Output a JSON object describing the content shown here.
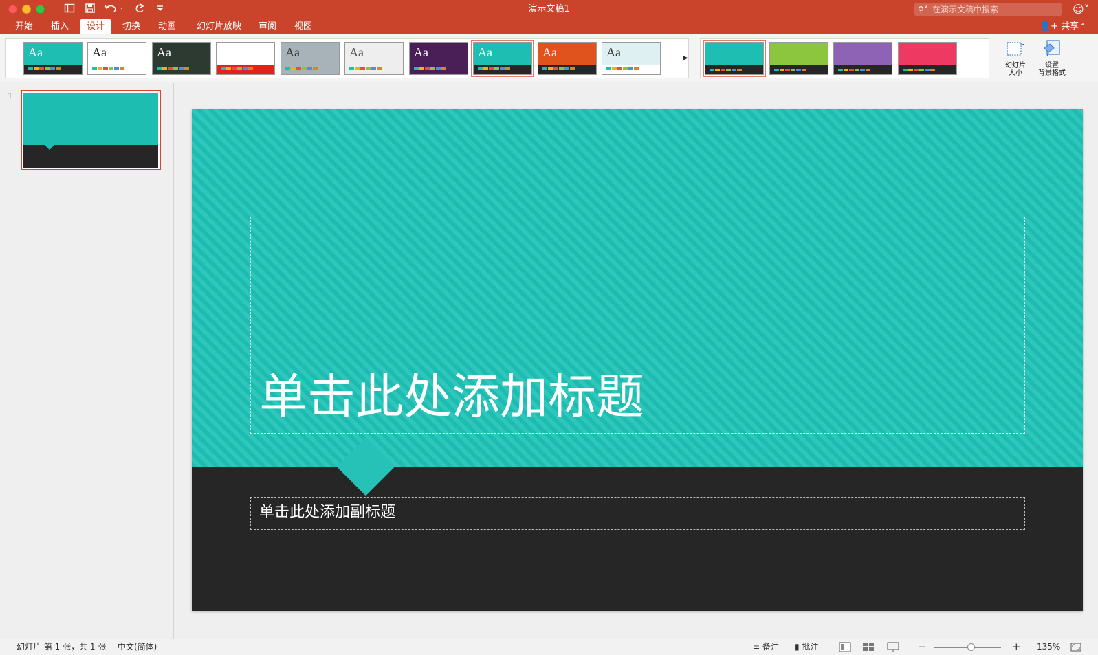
{
  "window": {
    "title": "演示文稿1",
    "search_placeholder": "在演示文稿中搜索"
  },
  "tabs": [
    "开始",
    "插入",
    "设计",
    "切换",
    "动画",
    "幻灯片放映",
    "审阅",
    "视图"
  ],
  "active_tab": "设计",
  "share_label": "共享",
  "themes": [
    {
      "aa": "Aa",
      "bg": "#1fbeb2",
      "band": "#262626",
      "text": "#ffffff"
    },
    {
      "aa": "Aa",
      "bg": "#ffffff",
      "band": "#ffffff",
      "text": "#222222"
    },
    {
      "aa": "Aa",
      "bg": "#2c3a32",
      "band": "#2c3a32",
      "text": "#ffffff"
    },
    {
      "aa": "Aa",
      "bg": "#ffffff",
      "band": "#e8201a",
      "text": "#ffffff"
    },
    {
      "aa": "Aa",
      "bg": "#a7b2b9",
      "band": "#a7b2b9",
      "text": "#333333"
    },
    {
      "aa": "Aa",
      "bg": "#eeeeee",
      "band": "#eeeeee",
      "text": "#555555"
    },
    {
      "aa": "Aa",
      "bg": "#4a1f57",
      "band": "#4a1f57",
      "text": "#ffffff"
    },
    {
      "aa": "Aa",
      "bg": "#1fbeb2",
      "band": "#262626",
      "text": "#ffffff"
    },
    {
      "aa": "Aa",
      "bg": "#e0531c",
      "band": "#262626",
      "text": "#ffffff"
    },
    {
      "aa": "Aa",
      "bg": "#dff0f2",
      "band": "#ffffff",
      "text": "#333333"
    }
  ],
  "variants": [
    {
      "color": "#1fbeb2"
    },
    {
      "color": "#8cc63f"
    },
    {
      "color": "#8e63b5"
    },
    {
      "color": "#ee3a63"
    }
  ],
  "ribbon_buttons": {
    "slide_size": "幻灯片\n大小",
    "format_background": "设置\n背景格式"
  },
  "slide": {
    "number": "1",
    "title_placeholder": "单击此处添加标题",
    "subtitle_placeholder": "单击此处添加副标题"
  },
  "status_bar": {
    "slide_info": "幻灯片 第 1 张，共 1 张",
    "language": "中文(简体)",
    "notes": "备注",
    "comments": "批注",
    "zoom": "135%"
  },
  "colors": {
    "accent": "#c9442b",
    "teal": "#1dbdb1",
    "dark": "#262626"
  }
}
